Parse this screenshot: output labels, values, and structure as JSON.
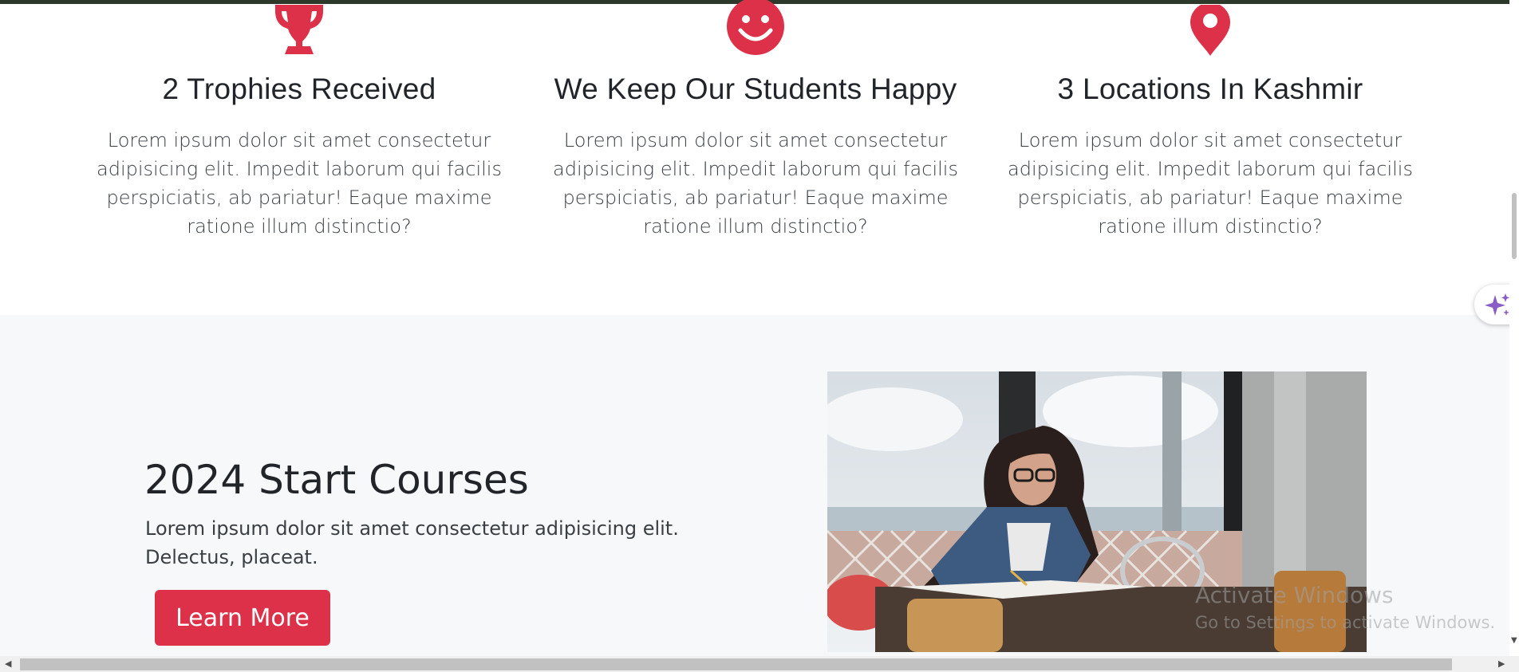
{
  "features": [
    {
      "icon": "trophy-icon",
      "title": "2 Trophies Received",
      "text": "Lorem ipsum dolor sit amet consectetur adipisicing elit. Impedit laborum qui facilis perspiciatis, ab pariatur! Eaque maxime ratione illum distinctio?"
    },
    {
      "icon": "smile-icon",
      "title": "We Keep Our Students Happy",
      "text": "Lorem ipsum dolor sit amet consectetur adipisicing elit. Impedit laborum qui facilis perspiciatis, ab pariatur! Eaque maxime ratione illum distinctio?"
    },
    {
      "icon": "location-pin-icon",
      "title": "3 Locations In Kashmir",
      "text": "Lorem ipsum dolor sit amet consectetur adipisicing elit. Impedit laborum qui facilis perspiciatis, ab pariatur! Eaque maxime ratione illum distinctio?"
    }
  ],
  "courses": {
    "title": "2024 Start Courses",
    "text": "Lorem ipsum dolor sit amet consectetur adipisicing elit. Delectus, placeat.",
    "button_label": "Learn More"
  },
  "watermark": {
    "line1": "Activate Windows",
    "line2": "Go to Settings to activate Windows."
  },
  "colors": {
    "accent": "#dc3148",
    "section_bg": "#f7f8fa"
  }
}
